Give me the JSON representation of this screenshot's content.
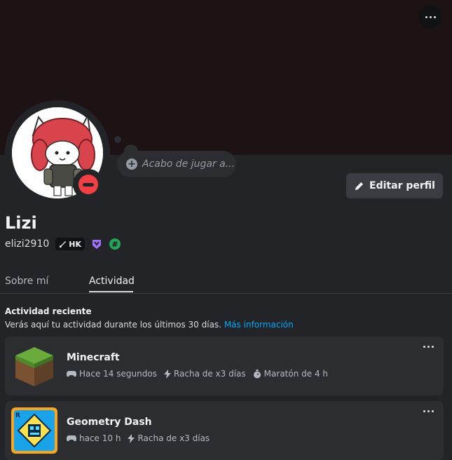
{
  "profile": {
    "display_name": "Lizi",
    "username": "elizi2910",
    "tag": "HK",
    "status_bubble_placeholder": "Acabo de jugar a...",
    "edit_button": "Editar perfil"
  },
  "tabs": [
    {
      "label": "Sobre mí",
      "active": false
    },
    {
      "label": "Actividad",
      "active": true
    }
  ],
  "activity": {
    "title": "Actividad reciente",
    "description": "Verás aquí tu actividad durante los últimos 30 días.",
    "link": "Más información",
    "items": [
      {
        "game": "Minecraft",
        "played": "Hace 14 segundos",
        "streak": "Racha de x3 días",
        "marathon": "Maratón de 4 h"
      },
      {
        "game": "Geometry Dash",
        "played": "hace 10 h",
        "streak": "Racha de x3 días"
      }
    ]
  },
  "colors": {
    "banner": "#1e1314",
    "status_dnd": "#f23f43",
    "link": "#00a8fc"
  }
}
